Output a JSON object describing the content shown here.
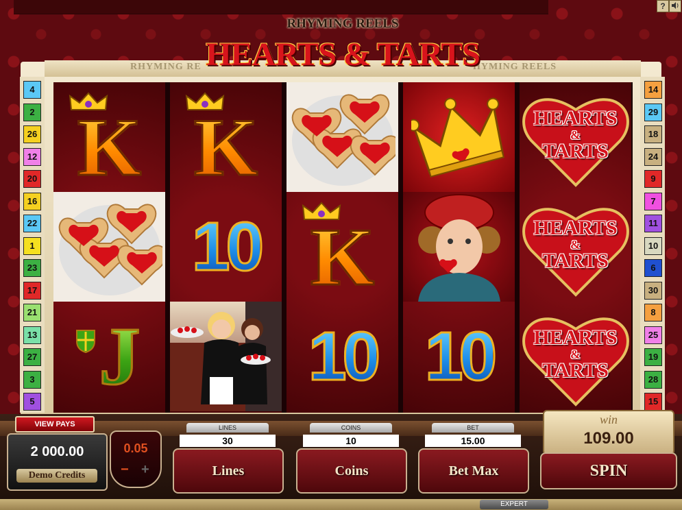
{
  "header": {
    "subtitle": "RHYMING REELS",
    "title": "HEARTS & TARTS",
    "banner_left": "RHYMING RE",
    "banner_right": "HYMING REELS",
    "help_label": "?",
    "sound_icon": "speaker-icon"
  },
  "reels": [
    [
      "K",
      "tarts",
      "J"
    ],
    [
      "K",
      "10",
      "waitresses"
    ],
    [
      "tarts",
      "K",
      "10"
    ],
    [
      "crown",
      "knave",
      "10"
    ],
    [
      "logo",
      "logo",
      "logo"
    ]
  ],
  "logo_text": {
    "line1": "HEARTS",
    "amp": "&",
    "line2": "TARTS"
  },
  "paylines_left": [
    {
      "n": "4",
      "color": "#5bc8f5"
    },
    {
      "n": "2",
      "color": "#3cb043"
    },
    {
      "n": "26",
      "color": "#f5d020"
    },
    {
      "n": "12",
      "color": "#f080e8"
    },
    {
      "n": "20",
      "color": "#e02828"
    },
    {
      "n": "16",
      "color": "#f5d020"
    },
    {
      "n": "22",
      "color": "#5bc8f5"
    },
    {
      "n": "1",
      "color": "#f5e020"
    },
    {
      "n": "23",
      "color": "#3cb043"
    },
    {
      "n": "17",
      "color": "#e02828"
    },
    {
      "n": "21",
      "color": "#9ae070"
    },
    {
      "n": "13",
      "color": "#7ae0a8"
    },
    {
      "n": "27",
      "color": "#3cb043"
    },
    {
      "n": "3",
      "color": "#3cb043"
    },
    {
      "n": "5",
      "color": "#a050e0"
    }
  ],
  "paylines_right": [
    {
      "n": "14",
      "color": "#f5a040"
    },
    {
      "n": "29",
      "color": "#5bc8f5"
    },
    {
      "n": "18",
      "color": "#c8b080"
    },
    {
      "n": "24",
      "color": "#c8b080"
    },
    {
      "n": "9",
      "color": "#e02828"
    },
    {
      "n": "7",
      "color": "#f050e0"
    },
    {
      "n": "11",
      "color": "#a050e0"
    },
    {
      "n": "10",
      "color": "#d8d8c0"
    },
    {
      "n": "6",
      "color": "#2050d0"
    },
    {
      "n": "30",
      "color": "#c8b080"
    },
    {
      "n": "8",
      "color": "#f5a040"
    },
    {
      "n": "25",
      "color": "#f080e8"
    },
    {
      "n": "19",
      "color": "#3cb043"
    },
    {
      "n": "28",
      "color": "#3cb043"
    },
    {
      "n": "15",
      "color": "#e02828"
    }
  ],
  "controls": {
    "view_pays": "VIEW PAYS",
    "credits_value": "2 000.00",
    "credits_label": "Demo Credits",
    "coin_value": "0.05",
    "coin_minus": "−",
    "coin_plus": "+",
    "lines_label": "LINES",
    "lines_value": "30",
    "lines_button": "Lines",
    "coins_label": "COINS",
    "coins_value": "10",
    "coins_button": "Coins",
    "bet_label": "BET",
    "bet_value": "15.00",
    "betmax_button": "Bet Max",
    "win_label": "win",
    "win_value": "109.00",
    "spin_button": "SPIN",
    "expert_label": "EXPERT"
  }
}
